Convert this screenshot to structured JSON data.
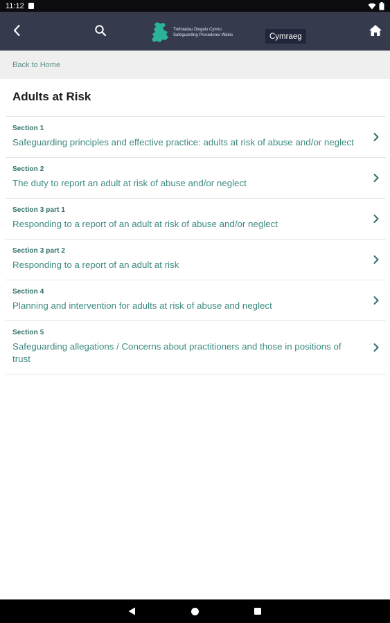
{
  "status_bar": {
    "time": "11:12"
  },
  "app_bar": {
    "logo_line1": "Trefniadau Diogelu Cymru",
    "logo_line2": "Safeguarding Procedures Wales",
    "language_button": "Cymraeg"
  },
  "breadcrumb": {
    "back_link": "Back to Home"
  },
  "page": {
    "title": "Adults at Risk"
  },
  "sections": [
    {
      "label": "Section 1",
      "title": "Safeguarding principles and effective practice: adults at risk of abuse and/or neglect"
    },
    {
      "label": "Section 2",
      "title": "The duty to report an adult at risk of abuse and/or neglect"
    },
    {
      "label": "Section 3 part 1",
      "title": "Responding to a report of an adult at risk of abuse and/or neglect"
    },
    {
      "label": "Section 3 part 2",
      "title": "Responding to a report of an adult at risk"
    },
    {
      "label": "Section 4",
      "title": "Planning and intervention for adults at risk of abuse and neglect"
    },
    {
      "label": "Section 5",
      "title": "Safeguarding allegations / Concerns about practitioners and those in positions of trust"
    }
  ],
  "colors": {
    "app_bar": "#353a4d",
    "accent": "#3c8a80",
    "logo_green": "#2bb39a"
  },
  "icons": [
    "back-arrow-icon",
    "search-icon",
    "wales-logo-icon",
    "home-icon",
    "chevron-right-icon",
    "wifi-icon",
    "battery-icon"
  ]
}
